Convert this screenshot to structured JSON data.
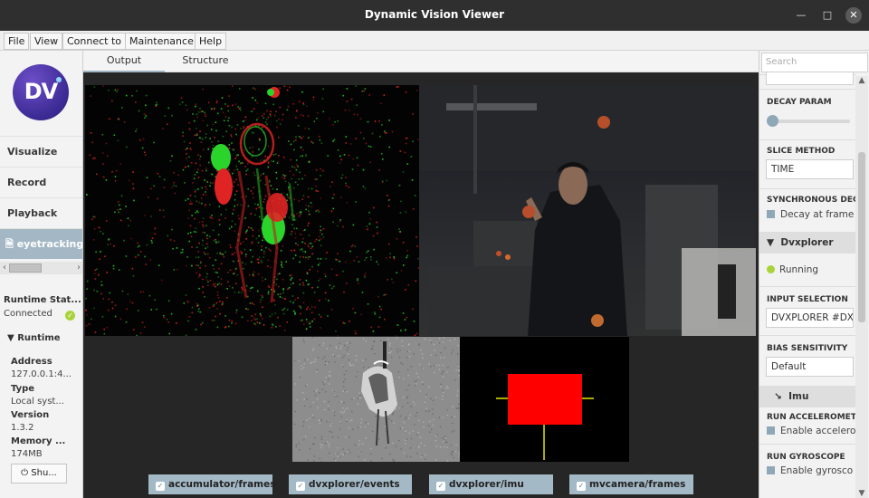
{
  "window": {
    "title": "Dynamic Vision Viewer"
  },
  "menu": [
    "File",
    "View",
    "Connect to",
    "Maintenance",
    "Help"
  ],
  "sidebar": {
    "logo_text": "DV",
    "nav": [
      "Visualize",
      "Record",
      "Playback"
    ],
    "active_file": "eyetracking-p",
    "runtime_status_label": "Runtime Stat...",
    "runtime_status_value": "Connected",
    "runtime_header": "Runtime",
    "fields": [
      {
        "label": "Address",
        "value": "127.0.0.1:4..."
      },
      {
        "label": "Type",
        "value": "Local syst..."
      },
      {
        "label": "Version",
        "value": "1.3.2"
      },
      {
        "label": "Memory ...",
        "value": "174MB"
      }
    ],
    "shutdown_label": "Shu..."
  },
  "tabs": [
    "Output",
    "Structure"
  ],
  "active_tab": "Output",
  "streams": [
    {
      "label": "accumulator/frames",
      "checked": true
    },
    {
      "label": "dvxplorer/events",
      "checked": true
    },
    {
      "label": "dvxplorer/imu",
      "checked": true
    },
    {
      "label": "mvcamera/frames",
      "checked": true
    }
  ],
  "right_panel": {
    "search_placeholder": "Search",
    "decay_param_label": "DECAY PARAM",
    "decay_param_value": 0.0,
    "slice_method_label": "SLICE METHOD",
    "slice_method_value": "TIME",
    "sync_decay_label": "SYNCHRONOUS DECA",
    "sync_decay_option": "Decay at frame",
    "dvxplorer_header": "Dvxplorer",
    "running_label": "Running",
    "input_selection_label": "INPUT SELECTION",
    "input_selection_value": "DVXPLORER #DX",
    "bias_label": "BIAS SENSITIVITY",
    "bias_value": "Default",
    "imu_header": "Imu",
    "run_accel_label": "RUN ACCELEROMETE",
    "run_accel_option": "Enable accelero",
    "run_gyro_label": "RUN GYROSCOPE",
    "run_gyro_option": "Enable gyrosco"
  },
  "colors": {
    "accent": "#a4b9c6",
    "event_on": "#2bd42b",
    "event_off": "#e02424",
    "imu_box": "#ff0000",
    "imu_axis": "#e6e600",
    "status_ok": "#a8d43a"
  }
}
